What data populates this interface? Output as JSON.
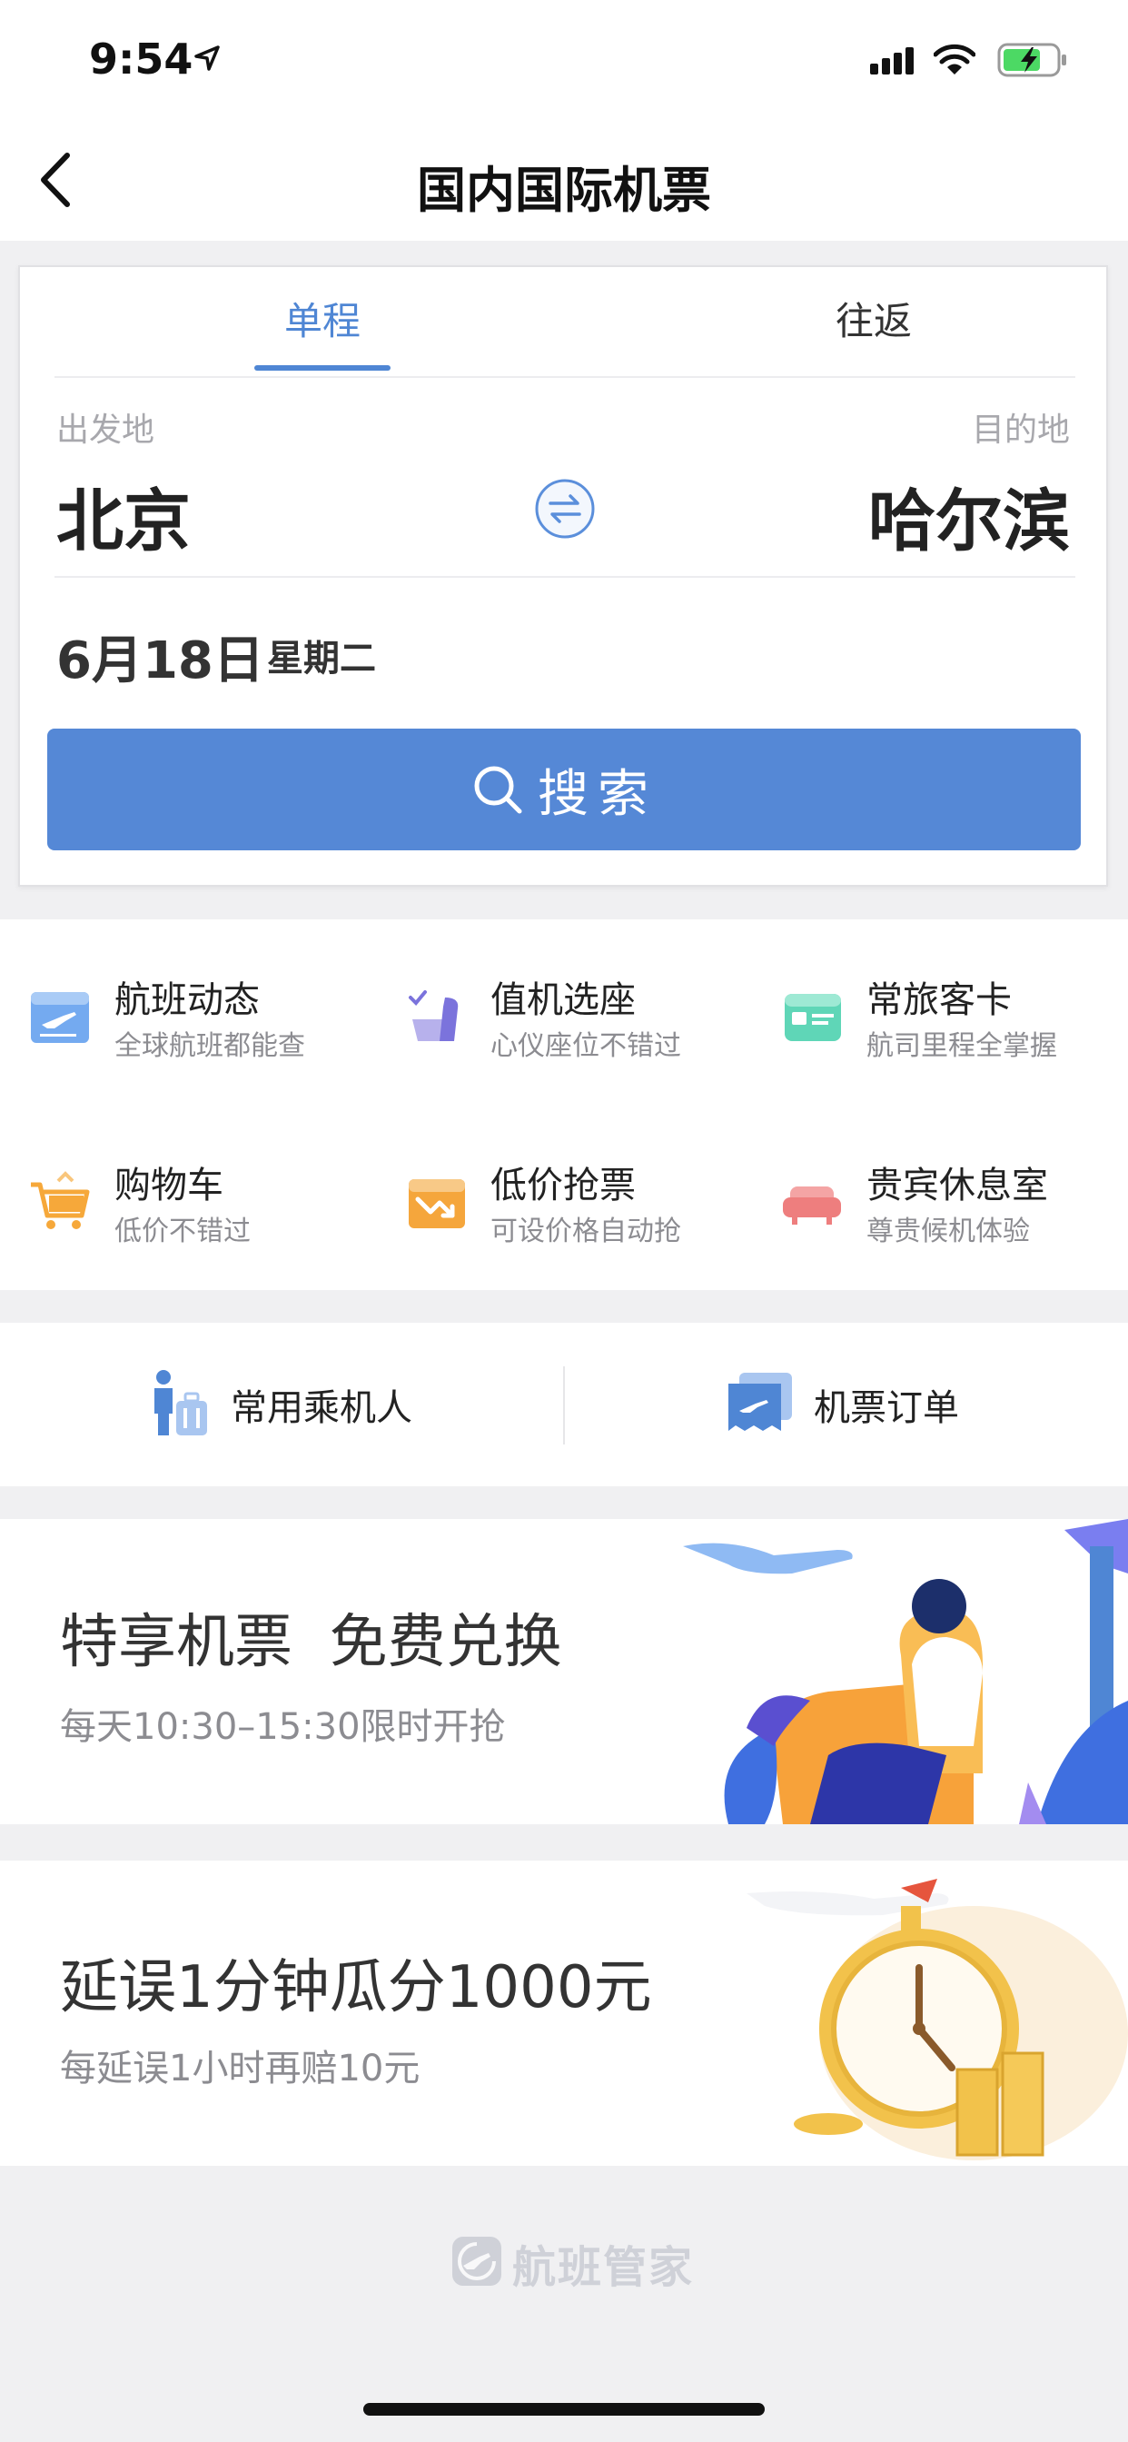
{
  "status_bar": {
    "time": "9:54"
  },
  "nav": {
    "title": "国内国际机票"
  },
  "search": {
    "tabs": {
      "oneway": "单程",
      "roundtrip": "往返"
    },
    "from_label": "出发地",
    "to_label": "目的地",
    "from_city": "北京",
    "to_city": "哈尔滨",
    "date": "6月18日",
    "weekday": "星期二",
    "button_label": "搜索"
  },
  "features": [
    {
      "title": "航班动态",
      "subtitle": "全球航班都能查",
      "icon": "flight-status-icon"
    },
    {
      "title": "值机选座",
      "subtitle": "心仪座位不错过",
      "icon": "seat-icon"
    },
    {
      "title": "常旅客卡",
      "subtitle": "航司里程全掌握",
      "icon": "member-card-icon"
    },
    {
      "title": "购物车",
      "subtitle": "低价不错过",
      "icon": "cart-icon"
    },
    {
      "title": "低价抢票",
      "subtitle": "可设价格自动抢",
      "icon": "low-price-icon"
    },
    {
      "title": "贵宾休息室",
      "subtitle": "尊贵候机体验",
      "icon": "lounge-icon"
    }
  ],
  "quick_links": [
    {
      "label": "常用乘机人",
      "icon": "passenger-icon"
    },
    {
      "label": "机票订单",
      "icon": "order-icon"
    }
  ],
  "banners": [
    {
      "title": "特享机票  免费兑换",
      "subtitle": "每天10:30–15:30限时开抢"
    },
    {
      "title": "延误1分钟瓜分1000元",
      "subtitle": "每延误1小时再赔10元"
    }
  ],
  "footer": {
    "brand": "航班管家"
  },
  "colors": {
    "accent": "#5588d6",
    "tab_active": "#4f86d4",
    "background": "#f0f0f2"
  }
}
